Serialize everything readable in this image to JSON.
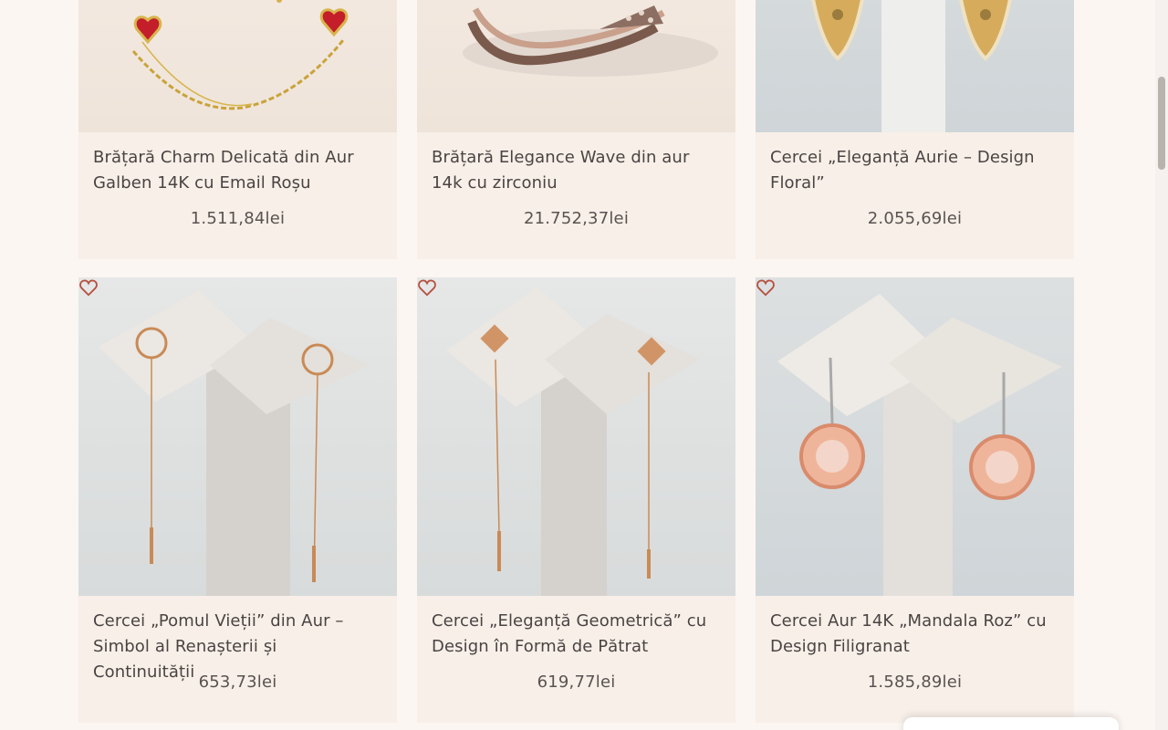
{
  "products": [
    {
      "title": "Brățară Charm Delicată din Aur Galben 14K cu Email Roșu",
      "price": "1.511,84lei",
      "image": "bracelet-red-hearts"
    },
    {
      "title": "Brățară Elegance Wave din aur 14k cu zirconiu",
      "price": "21.752,37lei",
      "image": "bracelet-wave"
    },
    {
      "title": "Cercei „Eleganță Aurie – Design Floral”",
      "price": "2.055,69lei",
      "image": "earrings-gold-floral"
    },
    {
      "title": "Cercei „Pomul Vieții” din Aur – Simbol al Renașterii și Continuității",
      "price": "653,73lei",
      "image": "earrings-tree-of-life"
    },
    {
      "title": "Cercei „Eleganță Geometrică” cu Design în Formă de Pătrat",
      "price": "619,77lei",
      "image": "earrings-square"
    },
    {
      "title": "Cercei Aur 14K „Mandala Roz” cu Design Filigranat",
      "price": "1.585,89lei",
      "image": "earrings-mandala-rose"
    }
  ],
  "colors": {
    "page_background": "#fbf6f1",
    "card_background": "#f7efe8",
    "heart_icon": "#b5513f",
    "text": "#4a4342"
  },
  "icons": {
    "wishlist": "heart-outline-icon"
  }
}
